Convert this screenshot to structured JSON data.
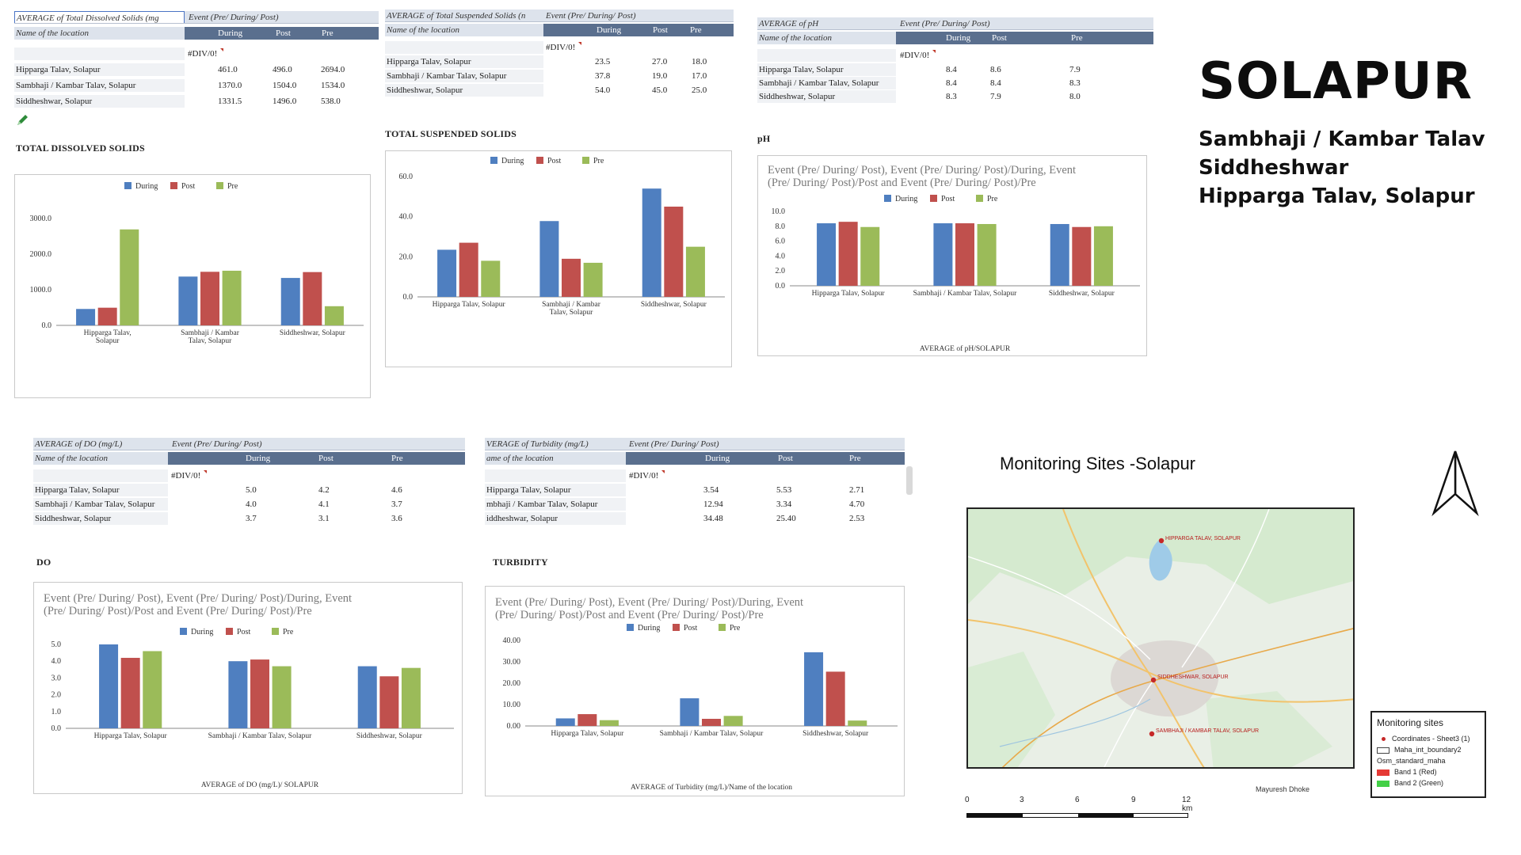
{
  "colors": {
    "during": "#4f7fc0",
    "post": "#c0504d",
    "pre": "#9bbb59",
    "header_dark": "#5a6f8e",
    "header_light": "#dde3ec"
  },
  "legend_labels": [
    "During",
    "Post",
    "Pre"
  ],
  "table_common": {
    "event_header": "Event (Pre/ During/ Post)",
    "location_header": "Name of the location",
    "col_during": "During",
    "col_post": "Post",
    "col_pre": "Pre",
    "error_value": "#DIV/0!",
    "locations": [
      "Hipparga Talav, Solapur",
      "Sambhaji / Kambar Talav, Solapur",
      "Siddheshwar, Solapur"
    ]
  },
  "panels": {
    "tds": {
      "table_title": "AVERAGE of Total Dissolved Solids (mg",
      "locations": [
        "Hipparga Talav, Solapur",
        "Sambhaji / Kambar Talav, Solapur",
        "Siddheshwar, Solapur"
      ],
      "rows": [
        [
          "461.0",
          "496.0",
          "2694.0"
        ],
        [
          "1370.0",
          "1504.0",
          "1534.0"
        ],
        [
          "1331.5",
          "1496.0",
          "538.0"
        ]
      ],
      "section_title": "TOTAL DISSOLVED SOLIDS"
    },
    "tss": {
      "table_title": "AVERAGE of Total Suspended Solids (n",
      "locations": [
        "Hipparga Talav, Solapur",
        "Sambhaji / Kambar Talav, Solapur",
        "Siddheshwar, Solapur"
      ],
      "rows": [
        [
          "23.5",
          "27.0",
          "18.0"
        ],
        [
          "37.8",
          "19.0",
          "17.0"
        ],
        [
          "54.0",
          "45.0",
          "25.0"
        ]
      ],
      "section_title": "TOTAL SUSPENDED SOLIDS"
    },
    "ph": {
      "table_title": "AVERAGE of pH",
      "locations": [
        "Hipparga Talav, Solapur",
        "Sambhaji / Kambar Talav, Solapur",
        "Siddheshwar, Solapur"
      ],
      "rows": [
        [
          "8.4",
          "8.6",
          "7.9"
        ],
        [
          "8.4",
          "8.4",
          "8.3"
        ],
        [
          "8.3",
          "7.9",
          "8.0"
        ]
      ],
      "section_title": "pH"
    },
    "do": {
      "table_title": "AVERAGE of DO (mg/L)",
      "locations": [
        "Hipparga Talav, Solapur",
        "Sambhaji / Kambar Talav, Solapur",
        "Siddheshwar, Solapur"
      ],
      "rows": [
        [
          "5.0",
          "4.2",
          "4.6"
        ],
        [
          "4.0",
          "4.1",
          "3.7"
        ],
        [
          "3.7",
          "3.1",
          "3.6"
        ]
      ],
      "section_title": "DO"
    },
    "turb": {
      "table_title": "VERAGE of Turbidity (mg/L)",
      "location_header": "ame of the location",
      "locations": [
        "Hipparga Talav, Solapur",
        "mbhaji / Kambar Talav, Solapur",
        "iddheshwar, Solapur"
      ],
      "rows": [
        [
          "3.54",
          "5.53",
          "2.71"
        ],
        [
          "12.94",
          "3.34",
          "4.70"
        ],
        [
          "34.48",
          "25.40",
          "2.53"
        ]
      ],
      "section_title": "TURBIDITY"
    }
  },
  "chart_data": [
    {
      "id": "tds",
      "type": "bar",
      "categories": [
        "Hipparga Talav, Solapur",
        "Sambhaji / Kambar Talav, Solapur",
        "Siddheshwar, Solapur"
      ],
      "tick_labels": [
        [
          "Hipparga Talav,",
          "Solapur"
        ],
        [
          "Sambhaji / Kambar",
          "Talav, Solapur"
        ],
        [
          "Siddheshwar, Solapur"
        ]
      ],
      "series": [
        {
          "name": "During",
          "values": [
            461.0,
            1370.0,
            1331.5
          ]
        },
        {
          "name": "Post",
          "values": [
            496.0,
            1504.0,
            1496.0
          ]
        },
        {
          "name": "Pre",
          "values": [
            2694.0,
            1534.0,
            538.0
          ]
        }
      ],
      "ylim": [
        0,
        3000
      ],
      "yticks": [
        "0.0",
        "1000.0",
        "2000.0",
        "3000.0"
      ],
      "title": "",
      "xlabel": "",
      "ylabel": "",
      "legend_position": "top",
      "grid": false
    },
    {
      "id": "tss",
      "type": "bar",
      "categories": [
        "Hipparga Talav, Solapur",
        "Sambhaji / Kambar Talav, Solapur",
        "Siddheshwar, Solapur"
      ],
      "tick_labels": [
        [
          "Hipparga Talav, Solapur"
        ],
        [
          "Sambhaji / Kambar",
          "Talav, Solapur"
        ],
        [
          "Siddheshwar, Solapur"
        ]
      ],
      "series": [
        {
          "name": "During",
          "values": [
            23.5,
            37.8,
            54.0
          ]
        },
        {
          "name": "Post",
          "values": [
            27.0,
            19.0,
            45.0
          ]
        },
        {
          "name": "Pre",
          "values": [
            18.0,
            17.0,
            25.0
          ]
        }
      ],
      "ylim": [
        0,
        60
      ],
      "yticks": [
        "0.0",
        "20.0",
        "40.0",
        "60.0"
      ],
      "title": "",
      "xlabel": "",
      "ylabel": "",
      "legend_position": "top",
      "grid": false
    },
    {
      "id": "ph",
      "type": "bar",
      "categories": [
        "Hipparga Talav, Solapur",
        "Sambhaji / Kambar Talav, Solapur",
        "Siddheshwar, Solapur"
      ],
      "tick_labels": [
        [
          "Hipparga Talav, Solapur"
        ],
        [
          "Sambhaji / Kambar Talav, Solapur"
        ],
        [
          "Siddheshwar, Solapur"
        ]
      ],
      "series": [
        {
          "name": "During",
          "values": [
            8.4,
            8.4,
            8.3
          ]
        },
        {
          "name": "Post",
          "values": [
            8.6,
            8.4,
            7.9
          ]
        },
        {
          "name": "Pre",
          "values": [
            7.9,
            8.3,
            8.0
          ]
        }
      ],
      "ylim": [
        0,
        10
      ],
      "yticks": [
        "0.0",
        "2.0",
        "4.0",
        "6.0",
        "8.0",
        "10.0"
      ],
      "title": [
        "Event (Pre/ During/ Post), Event (Pre/ During/ Post)/During, Event",
        "(Pre/ During/ Post)/Post and Event (Pre/ During/ Post)/Pre"
      ],
      "xlabel": "AVERAGE of pH/SOLAPUR",
      "ylabel": "",
      "legend_position": "top",
      "grid": false
    },
    {
      "id": "do",
      "type": "bar",
      "categories": [
        "Hipparga Talav, Solapur",
        "Sambhaji / Kambar Talav, Solapur",
        "Siddheshwar, Solapur"
      ],
      "tick_labels": [
        [
          "Hipparga Talav, Solapur"
        ],
        [
          "Sambhaji / Kambar Talav, Solapur"
        ],
        [
          "Siddheshwar, Solapur"
        ]
      ],
      "series": [
        {
          "name": "During",
          "values": [
            5.0,
            4.0,
            3.7
          ]
        },
        {
          "name": "Post",
          "values": [
            4.2,
            4.1,
            3.1
          ]
        },
        {
          "name": "Pre",
          "values": [
            4.6,
            3.7,
            3.6
          ]
        }
      ],
      "ylim": [
        0,
        5
      ],
      "yticks": [
        "0.0",
        "1.0",
        "2.0",
        "3.0",
        "4.0",
        "5.0"
      ],
      "title": [
        "Event (Pre/ During/ Post), Event (Pre/ During/ Post)/During, Event",
        "(Pre/ During/ Post)/Post and Event (Pre/ During/ Post)/Pre"
      ],
      "xlabel": "AVERAGE of DO (mg/L)/ SOLAPUR",
      "ylabel": "",
      "legend_position": "top",
      "grid": false
    },
    {
      "id": "turb",
      "type": "bar",
      "categories": [
        "Hipparga Talav, Solapur",
        "Sambhaji / Kambar Talav, Solapur",
        "Siddheshwar, Solapur"
      ],
      "tick_labels": [
        [
          "Hipparga Talav, Solapur"
        ],
        [
          "Sambhaji / Kambar Talav, Solapur"
        ],
        [
          "Siddheshwar, Solapur"
        ]
      ],
      "series": [
        {
          "name": "During",
          "values": [
            3.54,
            12.94,
            34.48
          ]
        },
        {
          "name": "Post",
          "values": [
            5.53,
            3.34,
            25.4
          ]
        },
        {
          "name": "Pre",
          "values": [
            2.71,
            4.7,
            2.53
          ]
        }
      ],
      "ylim": [
        0,
        40
      ],
      "yticks": [
        "0.00",
        "10.00",
        "20.00",
        "30.00",
        "40.00"
      ],
      "title": [
        "Event (Pre/ During/ Post), Event (Pre/ During/ Post)/During, Event",
        "(Pre/ During/ Post)/Post and Event (Pre/ During/ Post)/Pre"
      ],
      "xlabel": "AVERAGE of Turbidity (mg/L)/Name of the location",
      "ylabel": "",
      "legend_position": "top",
      "grid": false
    }
  ],
  "right": {
    "title": "SOLAPUR",
    "sites": [
      "Sambhaji / Kambar Talav",
      "Siddheshwar",
      "Hipparga Talav, Solapur"
    ],
    "north_arrow_icon": "north-arrow-icon"
  },
  "map": {
    "title": "Monitoring Sites -Solapur",
    "site_labels": [
      "HIPPARGA TALAV, SOLAPUR",
      "SIDDHESHWAR, SOLAPUR",
      "SAMBHAJI / KAMBAR TALAV, SOLAPUR"
    ],
    "legend_title": "Monitoring sites",
    "legend_items": [
      "Coordinates - Sheet3 (1)",
      "Maha_int_boundary2",
      "Osm_standard_maha",
      "Band 1 (Red)",
      "Band 2 (Green)"
    ],
    "scale_labels": [
      "0",
      "3",
      "6",
      "9",
      "12 km"
    ],
    "credit": "Mayuresh Dhoke",
    "marker_color": "#c62828"
  }
}
